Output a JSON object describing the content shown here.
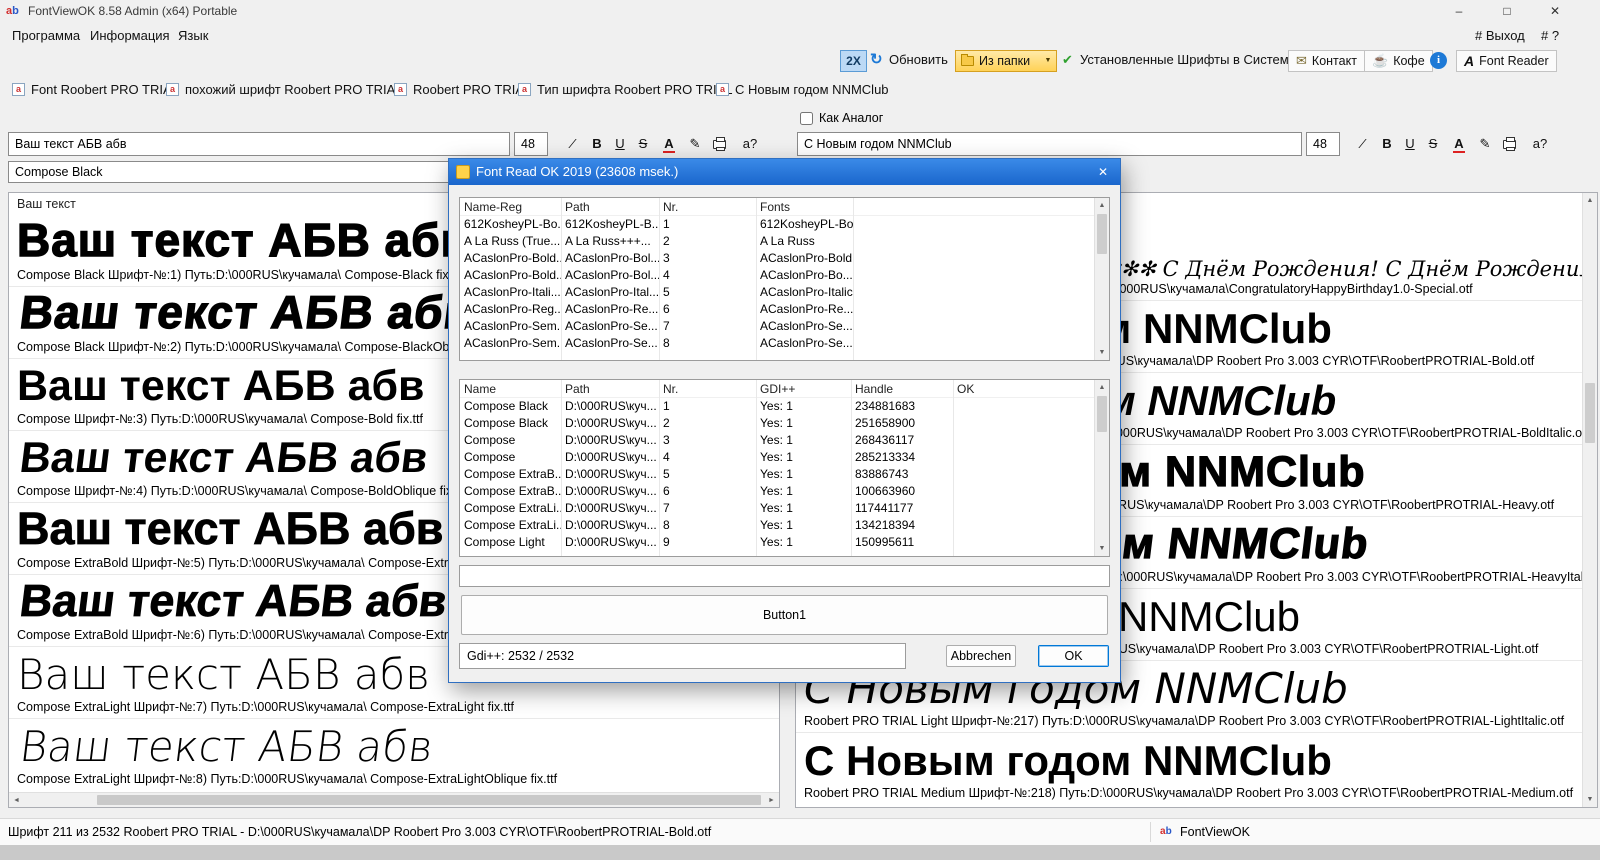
{
  "window": {
    "title": "FontViewOK 8.58 Admin (x64) Portable"
  },
  "menu": {
    "items": [
      "Программа",
      "Информация",
      "Язык"
    ],
    "exit": "# Выход",
    "help": "# ?"
  },
  "toolbar": {
    "zoom": "2X",
    "refresh": "Обновить",
    "from_folder": "Из папки",
    "installed_fonts": "Установленные Шрифты в Системе",
    "contact": "Контакт",
    "coffee": "Кофе",
    "font_reader": "Font Reader"
  },
  "tabs": [
    "Font Roobert PRO TRIAL",
    "похожий шрифт Roobert PRO TRIAL",
    "Roobert PRO TRIAL",
    "Тип шрифта Roobert PRO TRIAL",
    "С Новым годом NNMClub"
  ],
  "format_buttons": {
    "italic": "∕",
    "bold": "B",
    "underline": "U",
    "strike": "S",
    "color": "A",
    "edit": "✎",
    "info": "a?"
  },
  "left": {
    "sample_text": "Ваш текст АБВ абв",
    "font_size": "48",
    "font_combo": "Compose Black",
    "list_header": "Ваш текст",
    "previews": [
      {
        "sample": "Ваш текст АБВ абв",
        "caption": "Compose Black Шрифт-№:1) Путь:D:\\000RUS\\кучамала\\ Compose-Black fix.ttf"
      },
      {
        "sample": "Ваш текст АБВ абв",
        "caption": "Compose Black Шрифт-№:2) Путь:D:\\000RUS\\кучамала\\ Compose-BlackOblique fix.ttf"
      },
      {
        "sample": "Ваш текст АБВ абв",
        "caption": "Compose Шрифт-№:3) Путь:D:\\000RUS\\кучамала\\ Compose-Bold fix.ttf"
      },
      {
        "sample": "Ваш текст АБВ абв",
        "caption": "Compose Шрифт-№:4) Путь:D:\\000RUS\\кучамала\\ Compose-BoldOblique fix.ttf"
      },
      {
        "sample": "Ваш текст АБВ абв",
        "caption": "Compose ExtraBold Шрифт-№:5) Путь:D:\\000RUS\\кучамала\\ Compose-ExtraBold fix.ttf"
      },
      {
        "sample": "Ваш текст АБВ абв",
        "caption": "Compose ExtraBold Шрифт-№:6) Путь:D:\\000RUS\\кучамала\\ Compose-ExtraBoldOblique fix.ttf"
      },
      {
        "sample": "Ваш текст АБВ абв",
        "caption": "Compose ExtraLight Шрифт-№:7) Путь:D:\\000RUS\\кучамала\\ Compose-ExtraLight fix.ttf"
      },
      {
        "sample": "Ваш текст АБВ абв",
        "caption": "Compose ExtraLight Шрифт-№:8) Путь:D:\\000RUS\\кучамала\\ Compose-ExtraLightOblique fix.ttf"
      }
    ]
  },
  "right": {
    "analog_label": "Как Аналог",
    "sample_text": "С Новым годом NNMClub",
    "font_size": "48",
    "previews": [
      {
        "sample": "✻✻✻✻✻✻✻✻✻✻✻✻✻✻✻✻✻✻✻✻ С Днём Рождения! С Днём Рождения! С Днём Рождения!",
        "caption": "CongratulatoryHappyBirthday1.0 Шрифт-№:45) Путь:D:\\000RUS\\кучамала\\CongratulatoryHappyBirthday1.0-Special.otf"
      },
      {
        "sample": "С Новым годом NNMClub",
        "caption": "Roobert PRO TRIAL Bold Шрифт-№:212) Путь:D:\\000RUS\\кучамала\\DP Roobert Pro 3.003 CYR\\OTF\\RoobertPROTRIAL-Bold.otf"
      },
      {
        "sample": "С Новым годом NNMClub",
        "caption": "Roobert PRO TRIAL Bold Italic Шрифт-№:213) Путь:D:\\000RUS\\кучамала\\DP Roobert Pro 3.003 CYR\\OTF\\RoobertPROTRIAL-BoldItalic.otf"
      },
      {
        "sample": "С Новым годом NNMClub",
        "caption": "Roobert PRO TRIAL Heavy Шрифт-№:214) Путь:D:\\000RUS\\кучамала\\DP Roobert Pro 3.003 CYR\\OTF\\RoobertPROTRIAL-Heavy.otf"
      },
      {
        "sample": "С Новым годом NNMClub",
        "caption": "Roobert PRO TRIAL Heavy Italic Шрифт-№:215) Путь:D:\\000RUS\\кучамала\\DP Roobert Pro 3.003 CYR\\OTF\\RoobertPROTRIAL-HeavyItalic.otf"
      },
      {
        "sample": "С Новым годом NNMClub",
        "caption": "Roobert PRO TRIAL Light Шрифт-№:216) Путь:D:\\000RUS\\кучамала\\DP Roobert Pro 3.003 CYR\\OTF\\RoobertPROTRIAL-Light.otf"
      },
      {
        "sample": "С Новым годом NNMClub",
        "caption": "Roobert PRO TRIAL Light Шрифт-№:217) Путь:D:\\000RUS\\кучамала\\DP Roobert Pro 3.003 CYR\\OTF\\RoobertPROTRIAL-LightItalic.otf"
      },
      {
        "sample": "С Новым годом NNMClub",
        "caption": "Roobert PRO TRIAL Medium Шрифт-№:218) Путь:D:\\000RUS\\кучамала\\DP Roobert Pro 3.003 CYR\\OTF\\RoobertPROTRIAL-Medium.otf"
      }
    ]
  },
  "dialog": {
    "title": "Font Read OK 2019 (23608 msek.)",
    "top_table": {
      "columns": [
        "Name-Reg",
        "Path",
        "Nr.",
        "Fonts"
      ],
      "rows": [
        {
          "name_reg": "612KosheyPL-Bo...",
          "path": "612KosheyPL-B...",
          "nr": "1",
          "fonts": "612KosheyPL-Bold"
        },
        {
          "name_reg": "A La Russ (True...",
          "path": "A La Russ+++...",
          "nr": "2",
          "fonts": "A La Russ"
        },
        {
          "name_reg": "ACaslonPro-Bold...",
          "path": "ACaslonPro-Bol...",
          "nr": "3",
          "fonts": "ACaslonPro-Bold"
        },
        {
          "name_reg": "ACaslonPro-Bold...",
          "path": "ACaslonPro-Bol...",
          "nr": "4",
          "fonts": "ACaslonPro-Bo..."
        },
        {
          "name_reg": "ACaslonPro-Itali...",
          "path": "ACaslonPro-Ital...",
          "nr": "5",
          "fonts": "ACaslonPro-Italic"
        },
        {
          "name_reg": "ACaslonPro-Reg...",
          "path": "ACaslonPro-Re...",
          "nr": "6",
          "fonts": "ACaslonPro-Re..."
        },
        {
          "name_reg": "ACaslonPro-Sem...",
          "path": "ACaslonPro-Se...",
          "nr": "7",
          "fonts": "ACaslonPro-Se..."
        },
        {
          "name_reg": "ACaslonPro-Sem...",
          "path": "ACaslonPro-Se...",
          "nr": "8",
          "fonts": "ACaslonPro-Se..."
        }
      ]
    },
    "bottom_table": {
      "columns": [
        "Name",
        "Path",
        "Nr.",
        "GDI++",
        "Handle",
        "OK"
      ],
      "rows": [
        {
          "name": "Compose Black",
          "path": "D:\\000RUS\\куч...",
          "nr": "1",
          "gdi": "Yes: 1",
          "handle": "234881683"
        },
        {
          "name": "Compose Black",
          "path": "D:\\000RUS\\куч...",
          "nr": "2",
          "gdi": "Yes: 1",
          "handle": "251658900"
        },
        {
          "name": "Compose",
          "path": "D:\\000RUS\\куч...",
          "nr": "3",
          "gdi": "Yes: 1",
          "handle": "268436117"
        },
        {
          "name": "Compose",
          "path": "D:\\000RUS\\куч...",
          "nr": "4",
          "gdi": "Yes: 1",
          "handle": "285213334"
        },
        {
          "name": "Compose ExtraB...",
          "path": "D:\\000RUS\\куч...",
          "nr": "5",
          "gdi": "Yes: 1",
          "handle": "83886743"
        },
        {
          "name": "Compose ExtraB...",
          "path": "D:\\000RUS\\куч...",
          "nr": "6",
          "gdi": "Yes: 1",
          "handle": "100663960"
        },
        {
          "name": "Compose ExtraLi...",
          "path": "D:\\000RUS\\куч...",
          "nr": "7",
          "gdi": "Yes: 1",
          "handle": "117441177"
        },
        {
          "name": "Compose ExtraLi...",
          "path": "D:\\000RUS\\куч...",
          "nr": "8",
          "gdi": "Yes: 1",
          "handle": "134218394"
        },
        {
          "name": "Compose Light",
          "path": "D:\\000RUS\\куч...",
          "nr": "9",
          "gdi": "Yes: 1",
          "handle": "150995611"
        }
      ]
    },
    "button1": "Button1",
    "gdi_status": "Gdi++: 2532 / 2532",
    "cancel_label": "Abbrechen",
    "ok_label": "OK"
  },
  "status": {
    "left": "Шрифт 211 из 2532 Roobert PRO TRIAL - D:\\000RUS\\кучамала\\DP Roobert Pro 3.003 CYR\\OTF\\RoobertPROTRIAL-Bold.otf",
    "app": "FontViewOK"
  },
  "icons": {
    "minimize": "–",
    "maximize": "□",
    "close": "✕",
    "refresh": "↻",
    "dropdown": "▼",
    "check": "✔",
    "envelope": "✉",
    "coffee": "☕",
    "info_i": "i",
    "reader_a": "A",
    "font_a": "a",
    "left": "◄",
    "right": "►",
    "up": "▲",
    "down": "▼",
    "logo_a": "a",
    "logo_b": "b"
  }
}
